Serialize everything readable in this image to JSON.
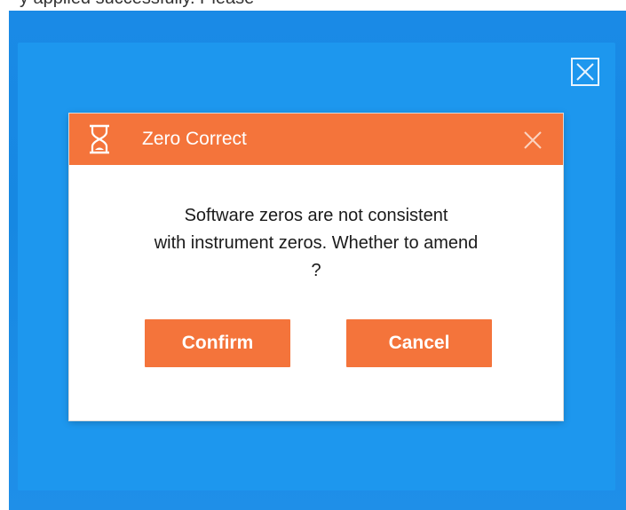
{
  "top_strip": {
    "text": "y applied successfully. Please"
  },
  "window": {
    "close_icon": "close-icon"
  },
  "dialog": {
    "icon": "hourglass-icon",
    "title": "Zero Correct",
    "close_icon": "close-icon",
    "message_lines": [
      "Software zeros are not consistent",
      "with instrument zeros. Whether to amend",
      "?"
    ],
    "confirm_label": "Confirm",
    "cancel_label": "Cancel"
  },
  "colors": {
    "accent": "#f4743b",
    "desktop_blue": "#1a8ae6",
    "panel_blue": "#1d97ee"
  }
}
